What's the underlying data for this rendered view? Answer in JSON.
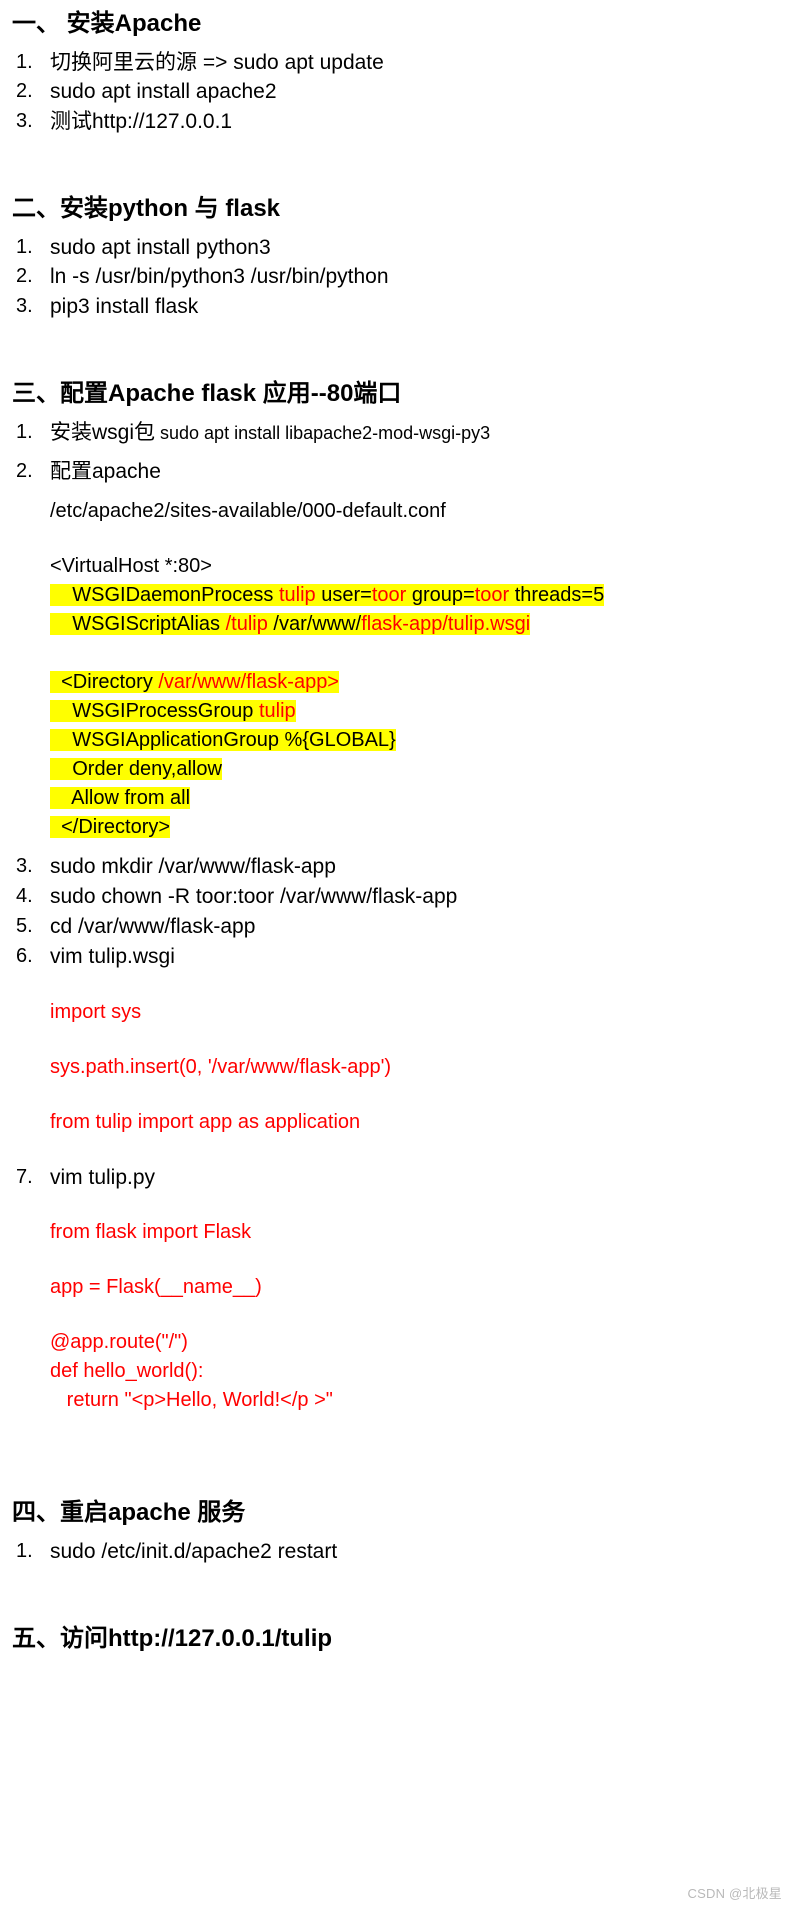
{
  "document": {
    "watermark": "CSDN @北极星"
  },
  "sections": [
    {
      "id": "install-apache",
      "title": "一、 安装Apache",
      "steps": [
        {
          "num": "1.",
          "text": "切换阿里云的源 => sudo apt update"
        },
        {
          "num": "2.",
          "text": "sudo apt install apache2"
        },
        {
          "num": "3.",
          "text": "测试http://127.0.0.1"
        }
      ]
    },
    {
      "id": "install-python-flask",
      "title": "二、安装python 与 flask",
      "steps": [
        {
          "num": "1.",
          "text": "sudo apt install python3"
        },
        {
          "num": "2.",
          "text": "ln -s /usr/bin/python3 /usr/bin/python"
        },
        {
          "num": "3.",
          "text": "pip3 install flask"
        }
      ]
    },
    {
      "id": "configure-apache-flask",
      "title": "三、配置Apache flask 应用--80端口",
      "steps": [
        {
          "num": "1.",
          "text_cn": "安装wsgi包",
          "text_cmd": " sudo apt install libapache2-mod-wsgi-py3"
        },
        {
          "num": "2.",
          "text": "配置apache"
        },
        {
          "num": "3.",
          "text": "sudo mkdir /var/www/flask-app"
        },
        {
          "num": "4.",
          "text": "sudo chown -R toor:toor /var/www/flask-app"
        },
        {
          "num": "5.",
          "text": "cd /var/www/flask-app"
        },
        {
          "num": "6.",
          "text": "vim tulip.wsgi"
        },
        {
          "num": "7.",
          "text": "vim tulip.py"
        }
      ],
      "conf_path": "/etc/apache2/sites-available/000-default.conf",
      "vhost": {
        "open_tag": "<VirtualHost *:80>",
        "daemon_process": {
          "directive": "WSGIDaemonProcess ",
          "name": "tulip",
          "user_label": " user=",
          "user": "toor",
          "group_label": " group=",
          "group": "toor",
          "threads": " threads=5"
        },
        "script_alias": {
          "directive": "WSGIScriptAlias ",
          "alias": "/tulip",
          "path_prefix": " /var/www/",
          "path_suffix": "flask-app/tulip.wsgi"
        },
        "directory": {
          "open_prefix": "<Directory ",
          "open_path": "/var/www/flask-app>",
          "process_group_label": "WSGIProcessGroup ",
          "process_group": "tulip",
          "application_group": "WSGIApplicationGroup %{GLOBAL}",
          "order": "Order deny,allow",
          "allow": "Allow from all",
          "close_tag": "</Directory>"
        }
      },
      "wsgi_code": [
        "import sys",
        "",
        "sys.path.insert(0, '/var/www/flask-app')",
        "",
        "from tulip import app as application"
      ],
      "py_code": [
        "from flask import Flask",
        "",
        "app = Flask(__name__)",
        "",
        "@app.route(\"/\")",
        "def hello_world():"
      ],
      "py_code_return": "   return \"<p>Hello, World!</p >\""
    },
    {
      "id": "restart-apache",
      "title": "四、重启apache 服务",
      "steps": [
        {
          "num": "1.",
          "text": "sudo /etc/init.d/apache2 restart"
        }
      ]
    },
    {
      "id": "visit-app",
      "title": "五、访问http://127.0.0.1/tulip",
      "steps": []
    }
  ],
  "colors": {
    "highlight": "#ffff00",
    "accent_red": "#ff0000",
    "text": "#000000",
    "watermark": "#b9b9b9"
  }
}
